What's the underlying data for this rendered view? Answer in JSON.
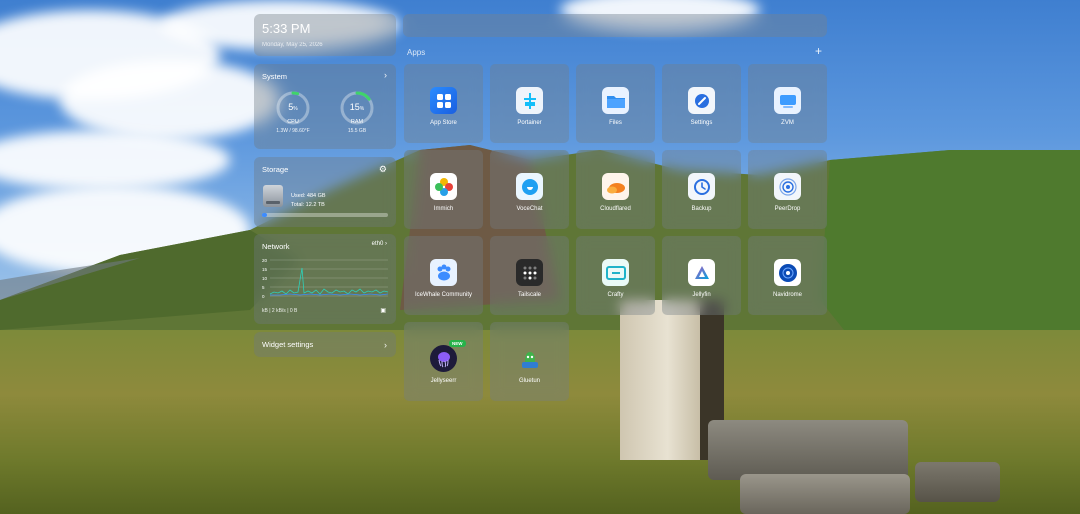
{
  "clock": {
    "time": "5:33 PM",
    "date": "Monday, May 25, 2026"
  },
  "apps_section": {
    "title": "Apps",
    "add_symbol": "+"
  },
  "system": {
    "title": "System",
    "cpu": {
      "value": "5",
      "unit": "%",
      "label": "CPU",
      "detail": "1.3W / 98.60°F",
      "percent": 5
    },
    "ram": {
      "value": "15",
      "unit": "%",
      "label": "RAM",
      "detail": "15.5 GB",
      "percent": 15
    }
  },
  "storage": {
    "title": "Storage",
    "used": "Used: 484 GB",
    "total": "Total: 12.2 TB",
    "fill_fraction": 0.04
  },
  "network": {
    "title": "Network",
    "interface": "eth0",
    "y_ticks": [
      "20",
      "15",
      "10",
      "5",
      "0"
    ],
    "footer": "kB  |  2 kB/s  |  0 B"
  },
  "widget_settings": {
    "label": "Widget settings"
  },
  "apps": [
    {
      "name": "App Store",
      "icon": "app-store-icon"
    },
    {
      "name": "Portainer",
      "icon": "portainer-icon"
    },
    {
      "name": "Files",
      "icon": "files-icon"
    },
    {
      "name": "Settings",
      "icon": "settings-icon"
    },
    {
      "name": "ZVM",
      "icon": "zvm-icon"
    },
    {
      "name": "Immich",
      "icon": "immich-icon"
    },
    {
      "name": "VoceChat",
      "icon": "vocechat-icon"
    },
    {
      "name": "Cloudflared",
      "icon": "cloudflared-icon"
    },
    {
      "name": "Backup",
      "icon": "backup-icon"
    },
    {
      "name": "PeerDrop",
      "icon": "peerdrop-icon"
    },
    {
      "name": "IceWhale Community",
      "icon": "icewhale-community-icon"
    },
    {
      "name": "Tailscale",
      "icon": "tailscale-icon"
    },
    {
      "name": "Crafty",
      "icon": "crafty-icon"
    },
    {
      "name": "Jellyfin",
      "icon": "jellyfin-icon"
    },
    {
      "name": "Navidrome",
      "icon": "navidrome-icon"
    },
    {
      "name": "Jellyseerr",
      "icon": "jellyseerr-icon",
      "badge": "NEW"
    },
    {
      "name": "Gluetun",
      "icon": "gluetun-icon"
    }
  ]
}
